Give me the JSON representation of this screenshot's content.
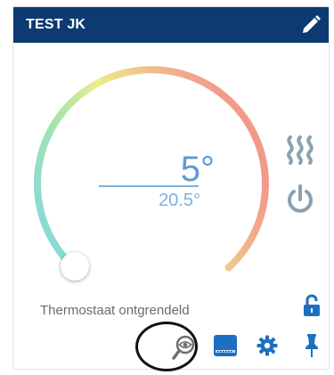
{
  "header": {
    "title": "TEST JK",
    "edit_icon": "pencil-icon"
  },
  "thermostat": {
    "setpoint": "5°",
    "current_temperature": "20.5°",
    "status_text": "Thermostaat ontgrendeld",
    "heating_icon": "heat-waves-icon",
    "power_icon": "power-icon",
    "lock_icon": "unlocked-padlock-icon"
  },
  "toolbar": {
    "icons": [
      "magnifier-eye-icon",
      "module-icon",
      "gear-icon",
      "pin-icon"
    ]
  },
  "colors": {
    "header_bg": "#0d3a72",
    "accent": "#1e6fc1",
    "setpoint_text": "#5b9bd5",
    "icon_gray": "#8aa1b1",
    "gauge_start": "#7fd6e6",
    "gauge_mid": "#d6e88a",
    "gauge_end": "#f2a08c"
  }
}
